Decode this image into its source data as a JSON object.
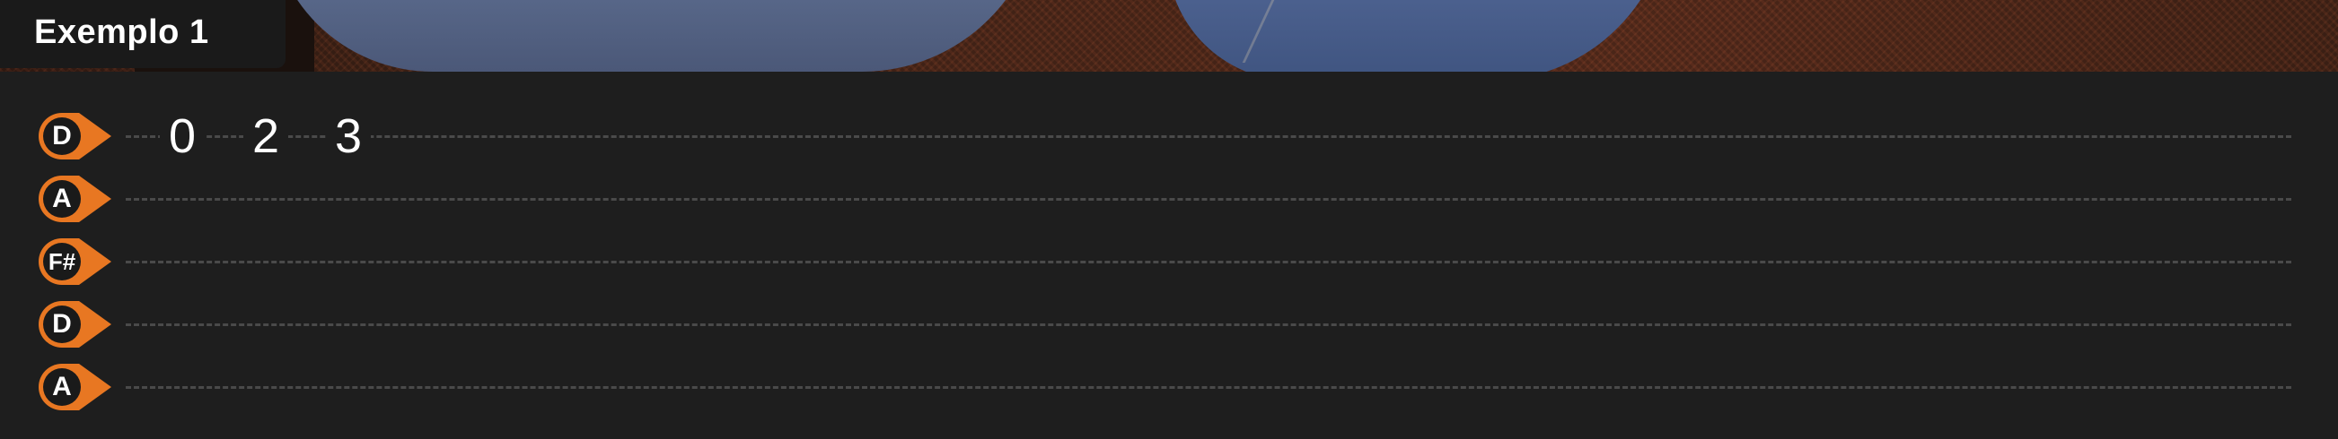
{
  "title": "Exemplo 1",
  "colors": {
    "accent": "#e87722",
    "background": "#1e1e1e",
    "tab_line": "#4a4a4a"
  },
  "tuning": [
    {
      "note": "D",
      "string": 1
    },
    {
      "note": "A",
      "string": 2
    },
    {
      "note": "F#",
      "string": 3
    },
    {
      "note": "D",
      "string": 4
    },
    {
      "note": "A",
      "string": 5
    }
  ],
  "notes": [
    {
      "string": 1,
      "fret": "0"
    },
    {
      "string": 1,
      "fret": "2"
    },
    {
      "string": 1,
      "fret": "3"
    }
  ]
}
